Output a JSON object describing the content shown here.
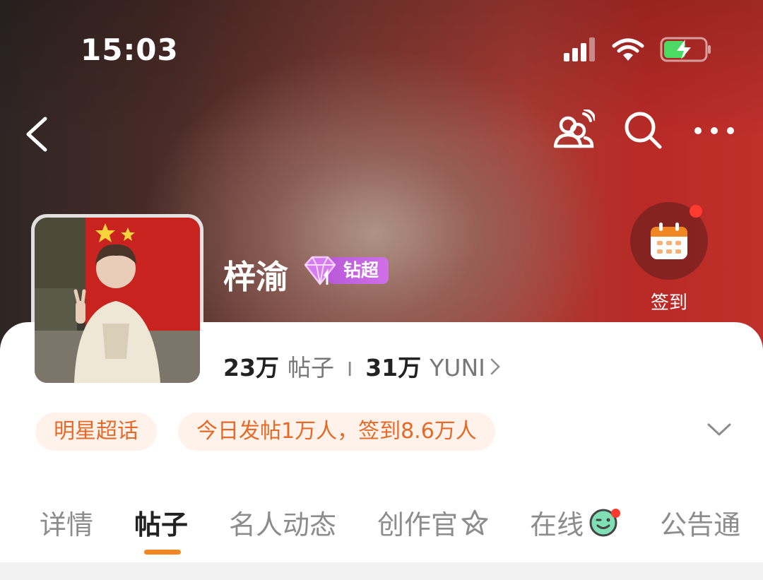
{
  "status": {
    "time": "15:03"
  },
  "topic": {
    "name": "梓渝",
    "badge_label": "钻超",
    "posts_count": "23万",
    "posts_label": "帖子",
    "separator": "I",
    "fans_count": "31万",
    "fans_label": "YUNI"
  },
  "checkin": {
    "label": "签到"
  },
  "tags": [
    {
      "label": "明星超话"
    },
    {
      "label": "今日发帖1万人，签到8.6万人"
    }
  ],
  "tabs": [
    {
      "label": "详情",
      "active": false
    },
    {
      "label": "帖子",
      "active": true
    },
    {
      "label": "名人动态",
      "active": false
    },
    {
      "label": "创作官",
      "active": false
    },
    {
      "label": "在线",
      "active": false
    },
    {
      "label": "公告通",
      "active": false
    }
  ],
  "colors": {
    "accent_orange": "#f08722",
    "tag_text": "#e36a28",
    "tag_bg": "#fff2ea",
    "badge_purple": "#c766e0",
    "notification_red": "#ff3b30"
  },
  "icons": {
    "back": "chevron-left-icon",
    "people": "group-chat-icon",
    "search": "search-icon",
    "more": "more-dots-icon",
    "calendar": "calendar-icon",
    "expand": "chevron-down-icon"
  }
}
